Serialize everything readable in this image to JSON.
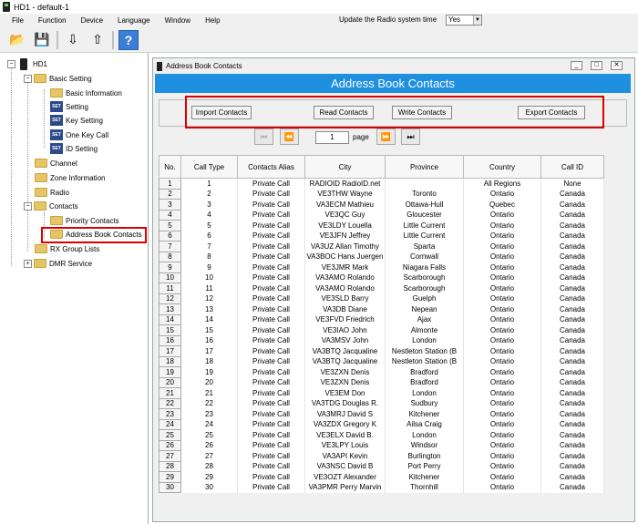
{
  "app": {
    "title": "HD1  -  default-1"
  },
  "menu": {
    "items": [
      "File",
      "Function",
      "Device",
      "Language",
      "Window",
      "Help"
    ],
    "update_label": "Update the Radio system time",
    "update_value": "Yes"
  },
  "tree": {
    "root": "HD1",
    "basic": "Basic Setting",
    "basic_info": "Basic Information",
    "setting": "Setting",
    "key_setting": "Key Setting",
    "one_key": "One Key Call",
    "id_setting": "ID Setting",
    "channel": "Channel",
    "zone": "Zone Information",
    "radio": "Radio",
    "contacts": "Contacts",
    "priority": "Priority Contacts",
    "address_book": "Address Book Contacts",
    "rx_group": "RX Group Lists",
    "dmr": "DMR Service"
  },
  "window": {
    "title": "Address Book Contacts",
    "banner": "Address Book Contacts",
    "buttons": {
      "import": "Import Contacts",
      "read": "Read Contacts",
      "write": "Write Contacts",
      "export": "Export Contacts"
    },
    "pager": {
      "page_value": "1",
      "page_label": "page"
    }
  },
  "table": {
    "columns": [
      "No.",
      "Call Type",
      "Contacts Alias",
      "City",
      "Province",
      "Country",
      "Call ID"
    ],
    "rows": [
      [
        "1",
        "1",
        "Private Call",
        "RADIOID RadioID.net",
        "",
        "All Regions",
        "None"
      ],
      [
        "2",
        "2",
        "Private Call",
        "VE3THW Wayne",
        "Toronto",
        "Ontario",
        "Canada"
      ],
      [
        "3",
        "3",
        "Private Call",
        "VA3ECM Mathieu",
        "Ottawa-Hull",
        "Quebec",
        "Canada"
      ],
      [
        "4",
        "4",
        "Private Call",
        "VE3QC Guy",
        "Gloucester",
        "Ontario",
        "Canada"
      ],
      [
        "5",
        "5",
        "Private Call",
        "VE3LDY Louella",
        "Little Current",
        "Ontario",
        "Canada"
      ],
      [
        "6",
        "6",
        "Private Call",
        "VE3JFN Jeffrey",
        "Little Current",
        "Ontario",
        "Canada"
      ],
      [
        "7",
        "7",
        "Private Call",
        "VA3UZ Allan Timothy",
        "Sparta",
        "Ontario",
        "Canada"
      ],
      [
        "8",
        "8",
        "Private Call",
        "VA3BOC Hans Juergen",
        "Cornwall",
        "Ontario",
        "Canada"
      ],
      [
        "9",
        "9",
        "Private Call",
        "VE3JMR Mark",
        "Niagara Falls",
        "Ontario",
        "Canada"
      ],
      [
        "10",
        "10",
        "Private Call",
        "VA3AMO Rolando",
        "Scarborough",
        "Ontario",
        "Canada"
      ],
      [
        "11",
        "11",
        "Private Call",
        "VA3AMO Rolando",
        "Scarborough",
        "Ontario",
        "Canada"
      ],
      [
        "12",
        "12",
        "Private Call",
        "VE3SLD Barry",
        "Guelph",
        "Ontario",
        "Canada"
      ],
      [
        "13",
        "13",
        "Private Call",
        "VA3DB Diane",
        "Nepean",
        "Ontario",
        "Canada"
      ],
      [
        "14",
        "14",
        "Private Call",
        "VE3FVD Friedrich",
        "Ajax",
        "Ontario",
        "Canada"
      ],
      [
        "15",
        "15",
        "Private Call",
        "VE3IAO John",
        "Almonte",
        "Ontario",
        "Canada"
      ],
      [
        "16",
        "16",
        "Private Call",
        "VA3MSV John",
        "London",
        "Ontario",
        "Canada"
      ],
      [
        "17",
        "17",
        "Private Call",
        "VA3BTQ Jacqualine",
        "Nestleton Station (B",
        "Ontario",
        "Canada"
      ],
      [
        "18",
        "18",
        "Private Call",
        "VA3BTQ Jacqualine",
        "Nestleton Station (B",
        "Ontario",
        "Canada"
      ],
      [
        "19",
        "19",
        "Private Call",
        "VE3ZXN Denis",
        "Bradford",
        "Ontario",
        "Canada"
      ],
      [
        "20",
        "20",
        "Private Call",
        "VE3ZXN Denis",
        "Bradford",
        "Ontario",
        "Canada"
      ],
      [
        "21",
        "21",
        "Private Call",
        "VE3EM Don",
        "London",
        "Ontario",
        "Canada"
      ],
      [
        "22",
        "22",
        "Private Call",
        "VA3TDG Douglas R.",
        "Sudbury",
        "Ontario",
        "Canada"
      ],
      [
        "23",
        "23",
        "Private Call",
        "VA3MRJ David S",
        "Kitchener",
        "Ontario",
        "Canada"
      ],
      [
        "24",
        "24",
        "Private Call",
        "VA3ZDX Gregory K",
        "Ailsa Craig",
        "Ontario",
        "Canada"
      ],
      [
        "25",
        "25",
        "Private Call",
        "VE3ELX David B.",
        "London",
        "Ontario",
        "Canada"
      ],
      [
        "26",
        "26",
        "Private Call",
        "VE3LPY Louis",
        "Windsor",
        "Ontario",
        "Canada"
      ],
      [
        "27",
        "27",
        "Private Call",
        "VA3API Kevin",
        "Burlington",
        "Ontario",
        "Canada"
      ],
      [
        "28",
        "28",
        "Private Call",
        "VA3NSC David B",
        "Port Perry",
        "Ontario",
        "Canada"
      ],
      [
        "29",
        "29",
        "Private Call",
        "VE3OZT Alexander",
        "Kitchener",
        "Ontario",
        "Canada"
      ],
      [
        "30",
        "30",
        "Private Call",
        "VA3PMR Perry Marvin",
        "Thornhill",
        "Ontario",
        "Canada"
      ]
    ]
  },
  "colors": {
    "banner": "#1f8fe0",
    "highlight": "#dd0000"
  }
}
